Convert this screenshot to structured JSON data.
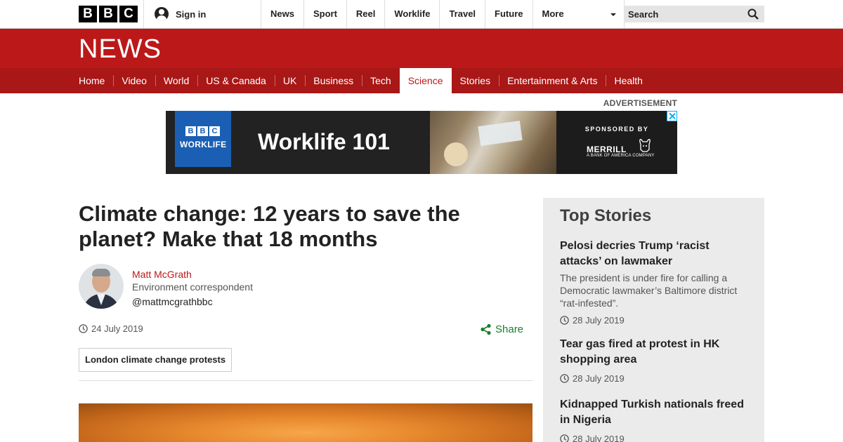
{
  "masthead": {
    "logo_letters": [
      "B",
      "B",
      "C"
    ],
    "sign_in": "Sign in",
    "nav": [
      "News",
      "Sport",
      "Reel",
      "Worklife",
      "Travel",
      "Future"
    ],
    "more": "More",
    "search_placeholder": "Search"
  },
  "news_header": {
    "wordmark": "NEWS",
    "sections": [
      {
        "label": "Home",
        "active": false
      },
      {
        "label": "Video",
        "active": false
      },
      {
        "label": "World",
        "active": false
      },
      {
        "label": "US & Canada",
        "active": false
      },
      {
        "label": "UK",
        "active": false
      },
      {
        "label": "Business",
        "active": false
      },
      {
        "label": "Tech",
        "active": false
      },
      {
        "label": "Science",
        "active": true
      },
      {
        "label": "Stories",
        "active": false
      },
      {
        "label": "Entertainment & Arts",
        "active": false
      },
      {
        "label": "Health",
        "active": false
      }
    ]
  },
  "advert": {
    "label": "ADVERTISEMENT",
    "badge_letters": [
      "B",
      "B",
      "C"
    ],
    "badge_sub": "WORKLIFE",
    "title": "Worklife 101",
    "sponsored_by": "SPONSORED BY",
    "sponsor_name": "MERRILL",
    "sponsor_sub": "A BANK OF AMERICA COMPANY"
  },
  "article": {
    "headline": "Climate change: 12 years to save the planet? Make that 18 months",
    "author": {
      "name": "Matt McGrath",
      "role": "Environment correspondent",
      "handle": "@mattmcgrathbbc"
    },
    "date": "24 July 2019",
    "share": "Share",
    "topic_tag": "London climate change protests"
  },
  "top_stories": {
    "title": "Top Stories",
    "stories": [
      {
        "headline": "Pelosi decries Trump ‘racist attacks’ on lawmaker",
        "summary": "The president is under fire for calling a Democratic lawmaker’s Baltimore district “rat-infested”.",
        "date": "28 July 2019"
      },
      {
        "headline": "Tear gas fired at protest in HK shopping area",
        "summary": "",
        "date": "28 July 2019"
      },
      {
        "headline": "Kidnapped Turkish nationals freed in Nigeria",
        "summary": "",
        "date": "28 July 2019"
      }
    ]
  },
  "colors": {
    "brand_red": "#bb1919",
    "nav_red": "#a91717",
    "share_green": "#1c7d2e",
    "sidebar_bg": "#ebebeb"
  },
  "icons": [
    "user-icon",
    "chevron-down-icon",
    "search-icon",
    "clock-icon",
    "share-icon",
    "bull-icon",
    "adchoices-icon"
  ]
}
